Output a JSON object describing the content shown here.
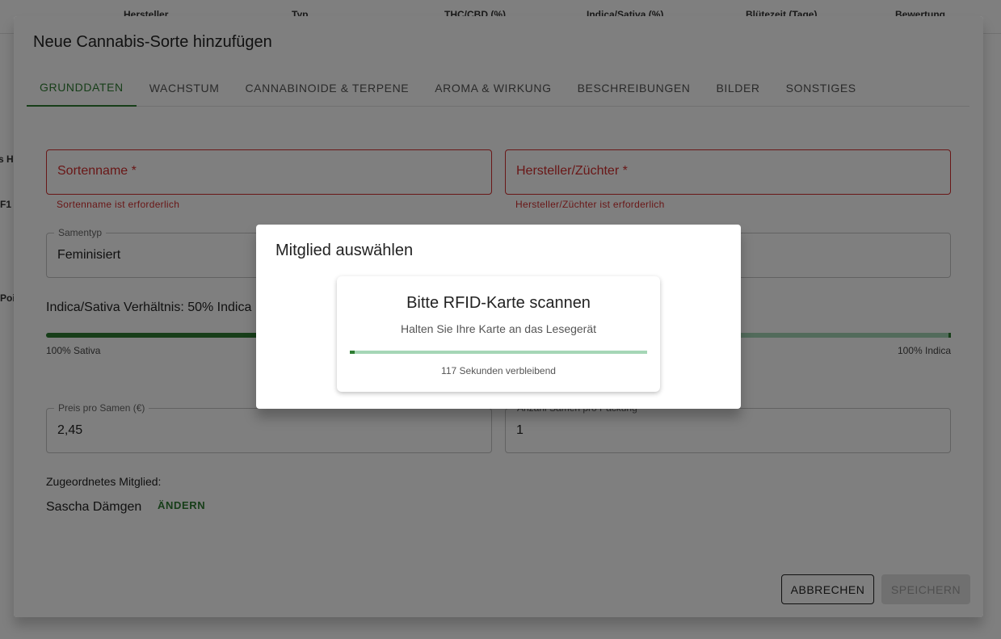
{
  "background": {
    "columns": [
      "Hersteller",
      "Typ",
      "THC/CBD (%)",
      "Indica/Sativa (%)",
      "Blütezeit (Tage)",
      "Bewertung"
    ],
    "side_fragments": [
      "s Ha",
      "F1",
      "Pois"
    ]
  },
  "dialog": {
    "title": "Neue Cannabis-Sorte hinzufügen",
    "tabs": [
      "GRUNDDATEN",
      "WACHSTUM",
      "CANNABINOIDE & TERPENE",
      "AROMA & WIRKUNG",
      "BESCHREIBUNGEN",
      "BILDER",
      "SONSTIGES"
    ],
    "active_tab": 0,
    "fields": {
      "strain_name": {
        "label": "Sortenname *",
        "error": "Sortenname ist erforderlich"
      },
      "breeder": {
        "label": "Hersteller/Züchter *",
        "error": "Hersteller/Züchter ist erforderlich"
      },
      "seed_type": {
        "label": "Samentyp",
        "value": "Feminisiert"
      },
      "price": {
        "label": "Preis pro Samen (€)",
        "value": "2,45"
      },
      "seeds_per_pack": {
        "label": "Anzahl Samen pro Packung",
        "value": "1"
      }
    },
    "ratio": {
      "label": "Indica/Sativa Verhältnis: 50% Indica",
      "value_percent": 50,
      "min_label": "100% Sativa",
      "max_label": "100% Indica"
    },
    "assigned_member": {
      "label": "Zugeordnetes Mitglied:",
      "name": "Sascha Dämgen",
      "change_label": "ÄNDERN"
    },
    "buttons": {
      "cancel": "ABBRECHEN",
      "save": "SPEICHERN"
    }
  },
  "modal": {
    "title": "Mitglied auswählen",
    "card_title": "Bitte RFID-Karte scannen",
    "card_subtitle": "Halten Sie Ihre Karte an das Lesegerät",
    "progress_fraction": 0.015,
    "time_remaining": "117 Sekunden verbleibend"
  },
  "colors": {
    "primary": "#2e7d32",
    "primary_light": "#a5d6b6",
    "error": "#d32f2f"
  }
}
